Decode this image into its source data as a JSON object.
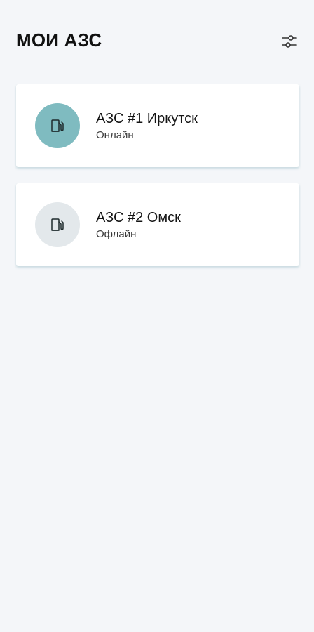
{
  "header": {
    "title": "МОИ АЗС",
    "filter_icon": "sliders-icon"
  },
  "stations": [
    {
      "name": "АЗС #1 Иркутск",
      "status": "Онлайн",
      "icon": "fuel-pump-icon",
      "avatar_color": "#7fbbc0"
    },
    {
      "name": "АЗС #2 Омск",
      "status": "Офлайн",
      "icon": "fuel-pump-icon",
      "avatar_color": "#e3e8eb"
    }
  ]
}
